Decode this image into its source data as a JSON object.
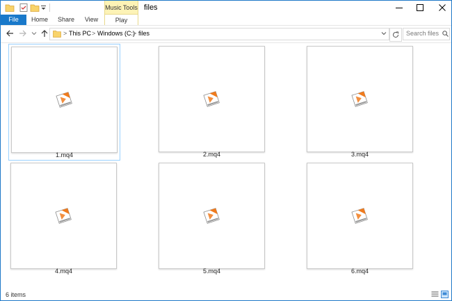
{
  "window": {
    "title": "files",
    "controls": {
      "minimize": "minimize",
      "maximize": "maximize",
      "close": "close"
    }
  },
  "ribbon": {
    "file_tab": "File",
    "tabs": [
      "Home",
      "Share",
      "View"
    ],
    "context_group": "Music Tools",
    "context_tab": "Play"
  },
  "address": {
    "crumbs": [
      "This PC",
      "Windows (C:)",
      "files"
    ],
    "search_placeholder": "Search files"
  },
  "files": [
    {
      "name": "1.mq4",
      "selected": true
    },
    {
      "name": "2.mq4",
      "selected": false
    },
    {
      "name": "3.mq4",
      "selected": false
    },
    {
      "name": "4.mq4",
      "selected": false
    },
    {
      "name": "5.mq4",
      "selected": false
    },
    {
      "name": "6.mq4",
      "selected": false
    }
  ],
  "status": {
    "item_count": "6 items"
  },
  "colors": {
    "accent": "#1979ca",
    "context_tab": "#fdf3b6",
    "selection_border": "#99d1ff",
    "file_icon_orange": "#f07b1d"
  }
}
